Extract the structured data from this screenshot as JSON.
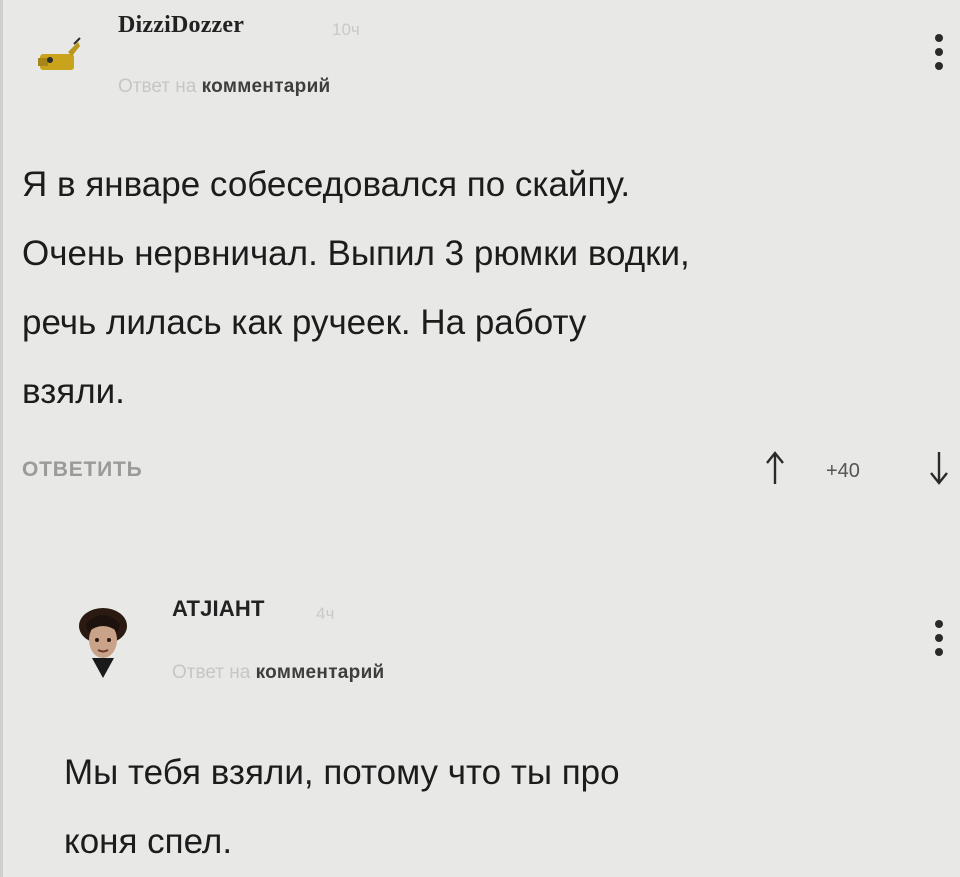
{
  "comments": [
    {
      "username": "DizziDozzer",
      "time": "10ч",
      "reply_prefix": "Ответ на ",
      "reply_target": "комментарий",
      "body": "Я в январе собеседовался по скайпу.\nОчень нервничал. Выпил 3 рюмки водки,\nречь лилась как ручеек. На работу\nвзяли.",
      "reply_button": "ОТВЕТИТЬ",
      "score": "+40",
      "avatar_icon": "yellow-creature-avatar-icon",
      "menu_icon": "more-vertical-icon"
    },
    {
      "username": "ATJIAHT",
      "time": "4ч",
      "reply_prefix": "Ответ на ",
      "reply_target": "комментарий",
      "body": "Мы тебя взяли, потому что ты про\nконя спел.",
      "avatar_icon": "man-portrait-avatar-icon",
      "menu_icon": "more-vertical-icon"
    }
  ],
  "icons": {
    "vote_up": "arrow-up-icon",
    "vote_down": "arrow-down-icon"
  },
  "colors": {
    "background": "#e8e8e6",
    "text": "#1c1c1c",
    "muted": "#c6c6c4"
  }
}
